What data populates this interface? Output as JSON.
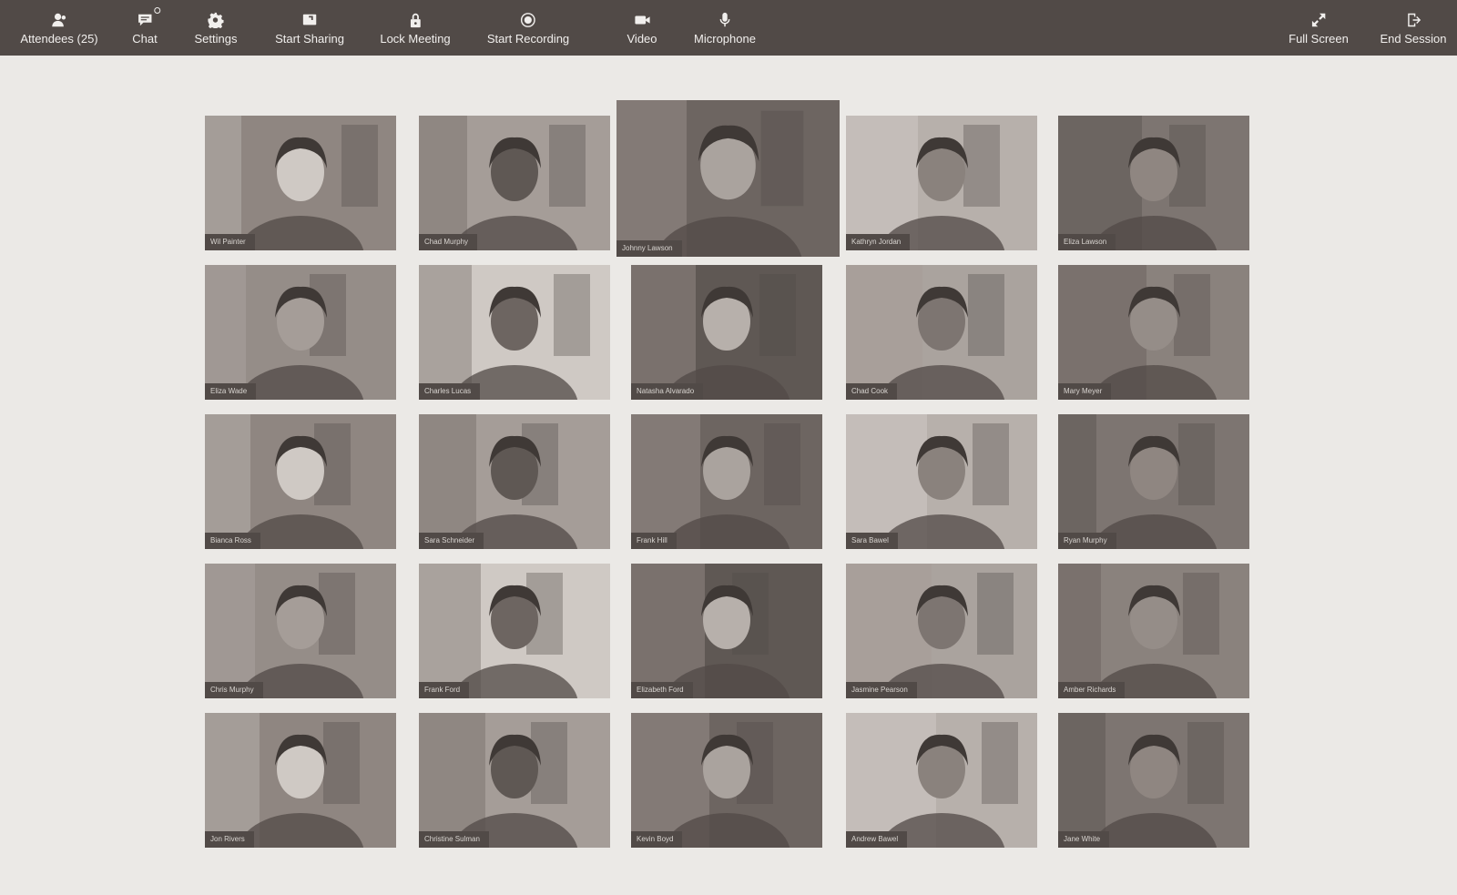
{
  "toolbar": {
    "left_buttons": [
      {
        "name": "attendees",
        "label": "Attendees (25)",
        "icon": "attendees-icon"
      },
      {
        "name": "chat",
        "label": "Chat",
        "icon": "chat-icon"
      },
      {
        "name": "settings",
        "label": "Settings",
        "icon": "gear-icon"
      },
      {
        "name": "start-sharing",
        "label": "Start Sharing",
        "icon": "share-screen-icon"
      },
      {
        "name": "lock-meeting",
        "label": "Lock Meeting",
        "icon": "lock-icon"
      },
      {
        "name": "start-recording",
        "label": "Start Recording",
        "icon": "record-icon"
      },
      {
        "name": "video",
        "label": "Video",
        "icon": "video-camera-icon"
      },
      {
        "name": "microphone",
        "label": "Microphone",
        "icon": "microphone-icon"
      }
    ],
    "right_buttons": [
      {
        "name": "full-screen",
        "label": "Full Screen",
        "icon": "expand-icon"
      },
      {
        "name": "end-session",
        "label": "End Session",
        "icon": "exit-icon"
      }
    ]
  },
  "active_speaker": "Johnny Lawson",
  "participants": [
    {
      "name": "Wil Painter"
    },
    {
      "name": "Chad Murphy"
    },
    {
      "name": "Johnny Lawson"
    },
    {
      "name": "Kathryn Jordan"
    },
    {
      "name": "Eliza Lawson"
    },
    {
      "name": "Eliza Wade"
    },
    {
      "name": "Charles Lucas"
    },
    {
      "name": "Natasha Alvarado"
    },
    {
      "name": "Chad Cook"
    },
    {
      "name": "Mary Meyer"
    },
    {
      "name": "Bianca Ross"
    },
    {
      "name": "Sara Schneider"
    },
    {
      "name": "Frank Hill"
    },
    {
      "name": "Sara Bawel"
    },
    {
      "name": "Ryan Murphy"
    },
    {
      "name": "Chris Murphy"
    },
    {
      "name": "Frank Ford"
    },
    {
      "name": "Elizabeth Ford"
    },
    {
      "name": "Jasmine Pearson"
    },
    {
      "name": "Amber Richards"
    },
    {
      "name": "Jon Rivers"
    },
    {
      "name": "Christine Sulman"
    },
    {
      "name": "Kevin Boyd"
    },
    {
      "name": "Andrew Bawel"
    },
    {
      "name": "Jane White"
    }
  ]
}
